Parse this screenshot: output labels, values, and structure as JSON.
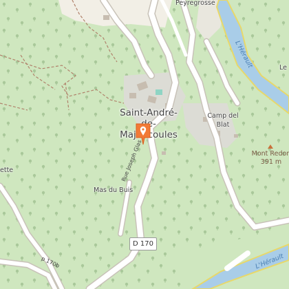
{
  "map": {
    "labels": {
      "town": "Saint-André-de-Majencoules",
      "hamlet_camp": "Camp del Blat",
      "hamlet_mas": "Mas du Buis",
      "top_place": "Peyregrosse",
      "top_right": "Le",
      "left_edge": "ette",
      "peak_name": "Mont Redon",
      "peak_elev": "391 m",
      "street": "Rue Joseph Glas",
      "road_ref": "D 170",
      "road_ref_partial": "p 170b",
      "river_top": "L'Hérault",
      "river_bottom": "L'Hérault"
    },
    "colors": {
      "forest": "#cfe7bf",
      "tree_dot": "#a9c89a",
      "built_area": "#dcdcd5",
      "building": "#c7bdb0",
      "road_casing": "#c8c2b8",
      "road": "#ffffff",
      "river": "#a9cde8",
      "river_edge": "#e8d86a",
      "path": "#b0826b",
      "marker": "#f27a36"
    }
  }
}
